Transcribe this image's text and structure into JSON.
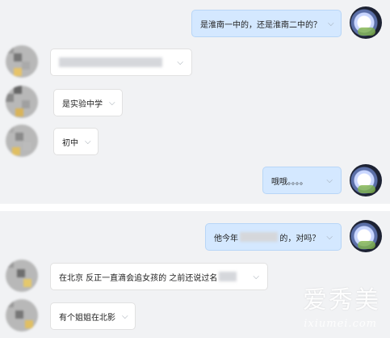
{
  "messages": [
    {
      "side": "right",
      "text": "是淮南一中的，还是淮南二中的？"
    },
    {
      "side": "left",
      "text": ""
    },
    {
      "side": "left",
      "text": "是实验中学"
    },
    {
      "side": "left",
      "text": "初中"
    },
    {
      "side": "right",
      "text": "哦哦。。。。"
    },
    {
      "side": "right",
      "text_prefix": "他今年",
      "text_suffix": "的，对吗？"
    },
    {
      "side": "left",
      "text": "在北京 反正一直滴会追女孩的 之前还说过名"
    },
    {
      "side": "left",
      "text": "有个姐姐在北影"
    }
  ],
  "dropdown_icon": "chevron-down-icon",
  "colors": {
    "bubble_right": "#d4e8ff",
    "bubble_left": "#ffffff",
    "background": "#f1f2f4"
  },
  "watermark": {
    "main": "爱秀美",
    "sub": "ixiumei.com"
  }
}
